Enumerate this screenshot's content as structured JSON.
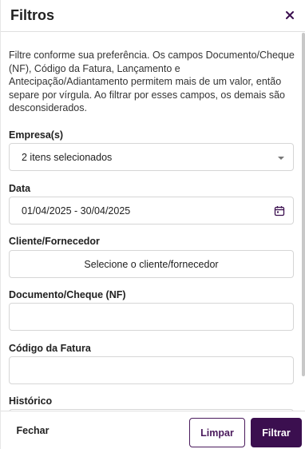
{
  "header": {
    "title": "Filtros",
    "close_icon": "close-icon"
  },
  "description": "Filtre conforme sua preferência. Os campos Documento/Cheque (NF), Código da Fatura, Lançamento e Antecipação/Adiantamento permitem mais de um valor, então separe por vírgula. Ao filtrar por esses campos, os demais são desconsiderados.",
  "fields": {
    "empresa": {
      "label": "Empresa(s)",
      "value": "2 itens selecionados",
      "icon": "chevron-down-icon"
    },
    "data": {
      "label": "Data",
      "value": "01/04/2025 - 30/04/2025",
      "icon": "calendar-icon"
    },
    "cliente": {
      "label": "Cliente/Fornecedor",
      "placeholder": "Selecione o cliente/fornecedor"
    },
    "documento": {
      "label": "Documento/Cheque (NF)",
      "value": ""
    },
    "fatura": {
      "label": "Código da Fatura",
      "value": ""
    },
    "historico": {
      "label": "Histórico"
    }
  },
  "footer": {
    "close_label": "Fechar",
    "clear_label": "Limpar",
    "filter_label": "Filtrar"
  },
  "colors": {
    "accent": "#3b0f4f",
    "border": "#d6d6d6"
  }
}
